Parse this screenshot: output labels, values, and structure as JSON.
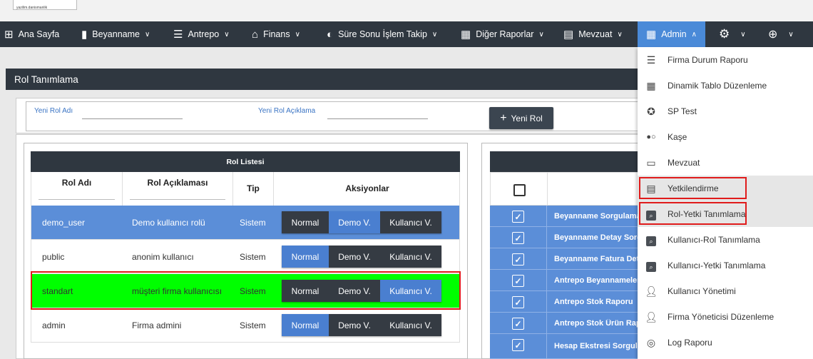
{
  "header": {
    "logo_text": "yazilim.danismanlik"
  },
  "nav": {
    "items": [
      {
        "label": "Ana Sayfa",
        "icon": "grid-icon"
      },
      {
        "label": "Beyanname",
        "icon": "bookmark-icon"
      },
      {
        "label": "Antrepo",
        "icon": "stack-icon"
      },
      {
        "label": "Finans",
        "icon": "bank-icon"
      },
      {
        "label": "Süre Sonu İşlem Takip",
        "icon": "circle-icon"
      },
      {
        "label": "Diğer Raporlar",
        "icon": "table-icon"
      },
      {
        "label": "Mevzuat",
        "icon": "list-icon"
      },
      {
        "label": "Admin",
        "icon": "table-icon"
      }
    ],
    "settings_icon": "gear-icon",
    "globe_icon": "globe-icon"
  },
  "page": {
    "title": "Rol Tanımlama",
    "yeni_rol_adi_label": "Yeni Rol Adı",
    "yeni_rol_aciklama_label": "Yeni Rol Açıklama",
    "yeni_rol_button": "Yeni Rol",
    "yeni_rol_adi_value": "",
    "yeni_rol_aciklama_value": ""
  },
  "rol_listesi": {
    "title": "Rol Listesi",
    "columns": [
      "Rol Adı",
      "Rol Açıklaması",
      "Tip",
      "Aksiyonlar"
    ],
    "rows": [
      {
        "rol_adi": "demo_user",
        "aciklama": "Demo kullanıcı rolü",
        "tip": "Sistem",
        "active": "Demo V."
      },
      {
        "rol_adi": "public",
        "aciklama": "anonim kullanıcı",
        "tip": "Sistem",
        "active": "Normal"
      },
      {
        "rol_adi": "standart",
        "aciklama": "müşteri firma kullanıcısı",
        "tip": "Sistem",
        "active": "Kullanıcı V."
      },
      {
        "rol_adi": "admin",
        "aciklama": "Firma admini",
        "tip": "Sistem",
        "active": "Normal"
      }
    ],
    "action_labels": [
      "Normal",
      "Demo V.",
      "Kullanıcı V."
    ]
  },
  "yetki_listesi": {
    "rows": [
      "Beyanname Sorgulama",
      "Beyanname Detay Sorgulama",
      "Beyanname Fatura Detay",
      "Antrepo Beyannameleri",
      "Antrepo Stok Raporu",
      "Antrepo Stok Ürün Raporu",
      "Hesap Ekstresi Sorgulama"
    ]
  },
  "admin_menu": {
    "items": [
      {
        "label": "Firma Durum Raporu",
        "icon": "list-icon"
      },
      {
        "label": "Dinamik Tablo Düzenleme",
        "icon": "grid-icon"
      },
      {
        "label": "SP Test",
        "icon": "film-icon"
      },
      {
        "label": "Kaşe",
        "icon": "toggle-icon"
      },
      {
        "label": "Mevzuat",
        "icon": "book-icon"
      },
      {
        "label": "Yetkilendirme",
        "icon": "list-alt-icon"
      },
      {
        "label": "Rol-Yetki Tanımlama",
        "icon": "search-icon"
      },
      {
        "label": "Kullanıcı-Rol Tanımlama",
        "icon": "search-icon"
      },
      {
        "label": "Kullanıcı-Yetki Tanımlama",
        "icon": "search-icon"
      },
      {
        "label": "Kullanıcı Yönetimi",
        "icon": "person-icon"
      },
      {
        "label": "Firma Yöneticisi Düzenleme",
        "icon": "person-icon"
      },
      {
        "label": "Log Raporu",
        "icon": "fingerprint-icon"
      }
    ]
  }
}
